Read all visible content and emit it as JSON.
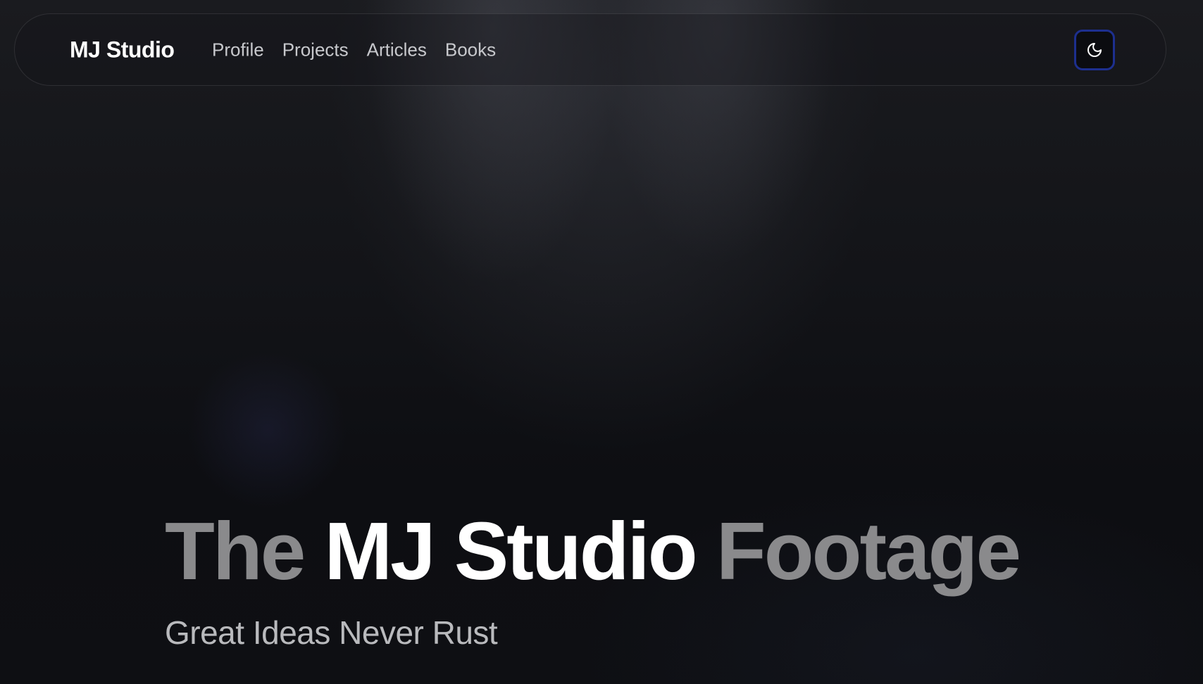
{
  "header": {
    "brand": "MJ Studio",
    "nav_items": [
      {
        "label": "Profile"
      },
      {
        "label": "Projects"
      },
      {
        "label": "Articles"
      },
      {
        "label": "Books"
      }
    ],
    "theme_toggle": {
      "icon": "moon-icon",
      "focus_ring_color": "#1d2f8f"
    }
  },
  "hero": {
    "title_prefix": "The",
    "title_highlight": "MJ Studio",
    "title_suffix": "Footage",
    "subtitle": "Great Ideas Never Rust"
  },
  "colors": {
    "background": "#0d0e11",
    "title_dim": "#8a8a8c",
    "title_bright": "#ffffff",
    "nav_text": "#c7c8cc"
  }
}
